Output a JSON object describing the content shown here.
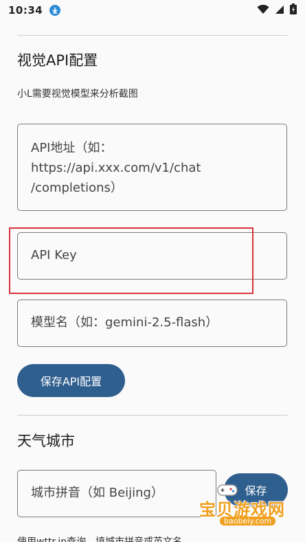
{
  "status_bar": {
    "time": "10:34"
  },
  "vision_api": {
    "title": "视觉API配置",
    "description": "小L需要视觉模型来分析截图",
    "url_placeholder": "API地址（如：https://api.xxx.com/v1/chat/completions）",
    "url_placeholder_lines": [
      "API地址（如：",
      "https://api.xxx.com/v1/chat",
      "/completions）"
    ],
    "key_placeholder": "API Key",
    "model_placeholder": "模型名（如：gemini-2.5-flash）",
    "save_label": "保存API配置"
  },
  "weather": {
    "title": "天气城市",
    "city_placeholder": "城市拼音（如 Beijing）",
    "save_label": "保存",
    "note": "使用wttr.in查询，填城市拼音或英文名"
  },
  "watermark": {
    "title": "宝贝游戏网",
    "url": "baobeiy.com"
  },
  "colors": {
    "primary": "#2f5f8f",
    "highlight": "#d8313a",
    "watermark": "#f0a020"
  },
  "icons": {
    "download": "download-icon",
    "wifi": "wifi-icon",
    "signal": "signal-icon",
    "battery": "battery-charging-icon"
  }
}
